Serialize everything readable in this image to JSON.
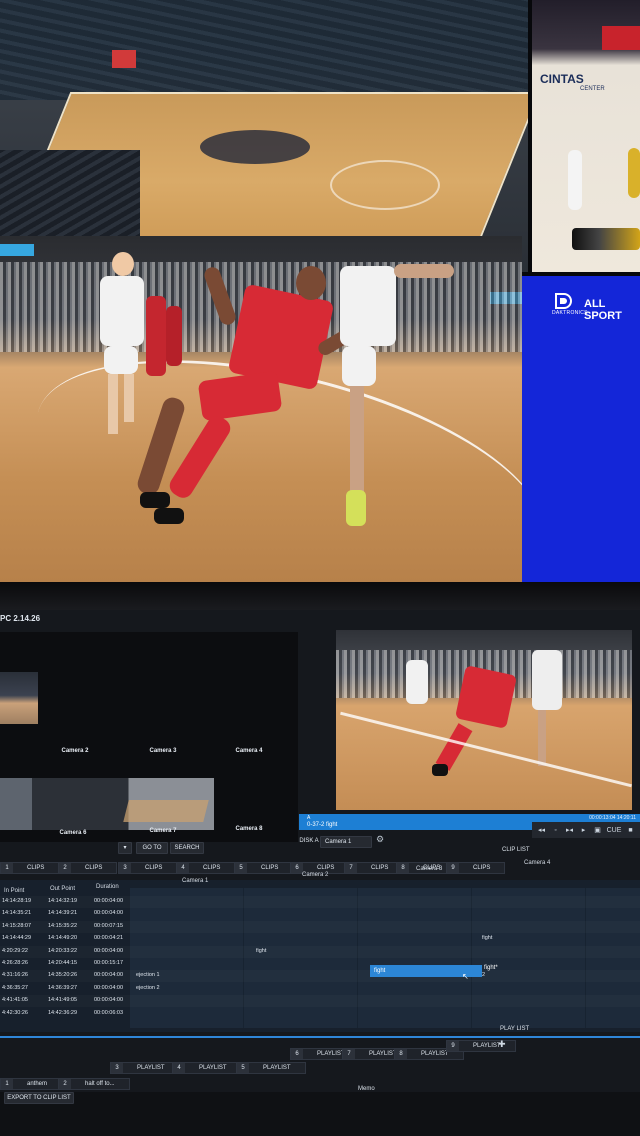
{
  "wall": {
    "sidecam_banner": "CINTAS",
    "sidecam_banner_sub": "CENTER",
    "bluegfx": {
      "brand": "ALL SPORT",
      "sub": "DAKTRONICS"
    }
  },
  "software": {
    "version": "PC 2.14.26",
    "cameras": [
      {
        "label": "Camera 2"
      },
      {
        "label": "Camera 3"
      },
      {
        "label": "Camera 4"
      },
      {
        "label": "Camera 6"
      },
      {
        "label": "Camera 7"
      },
      {
        "label": "Camera 8"
      }
    ],
    "clip": {
      "letter": "A",
      "name": "0-37-2  fight",
      "timecode": "00:00:13:04   14:20:11"
    },
    "transport": [
      "◂◂",
      "◦",
      "▸◂",
      "▸",
      "▣",
      "CUE",
      "■"
    ],
    "goto_label": "GO TO",
    "search_label": "SEARCH",
    "disk_label": "DISK A",
    "camera_select": "Camera 1",
    "cliplist_label": "CLIP LIST",
    "clip_tabs": [
      {
        "n": "1",
        "label": "CLIPS"
      },
      {
        "n": "2",
        "label": "CLIPS"
      },
      {
        "n": "3",
        "label": "CLIPS"
      },
      {
        "n": "4",
        "label": "CLIPS"
      },
      {
        "n": "5",
        "label": "CLIPS"
      },
      {
        "n": "6",
        "label": "CLIPS"
      },
      {
        "n": "7",
        "label": "CLIPS"
      },
      {
        "n": "8",
        "label": "CLIPS"
      },
      {
        "n": "9",
        "label": "CLIPS"
      }
    ],
    "columns": {
      "in_point": "In Point",
      "out_point": "Out Point",
      "duration": "Duration",
      "camera1": "Camera 1",
      "camera2": "Camera 2",
      "camera3": "Camera 3",
      "camera4": "Camera 4"
    },
    "rows": [
      {
        "in": "14:14:28:19",
        "out": "14:14:32:19",
        "dur": "00:00:04:00",
        "c1": "",
        "c2": "",
        "c3": ""
      },
      {
        "in": "14:14:35:21",
        "out": "14:14:39:21",
        "dur": "00:00:04:00",
        "c1": "",
        "c2": "",
        "c3": ""
      },
      {
        "in": "14:15:28:07",
        "out": "14:15:35:22",
        "dur": "00:00:07:15",
        "c1": "",
        "c2": "",
        "c3": ""
      },
      {
        "in": "14:14:44:29",
        "out": "14:14:49:20",
        "dur": "00:00:04:21",
        "c1": "",
        "c2": "",
        "c3": "fight"
      },
      {
        "in": "4:20:29:22",
        "out": "14:20:33:22",
        "dur": "00:00:04:00",
        "c1": "",
        "c2": "fight",
        "c3": ""
      },
      {
        "in": "4:26:28:26",
        "out": "14:20:44:15",
        "dur": "00:00:15:17",
        "c1": "",
        "c2": "",
        "c3": ""
      },
      {
        "in": "4:31:16:26",
        "out": "14:35:20:26",
        "dur": "00:00:04:00",
        "c1": "ejection 1",
        "c2": "",
        "c3": "2"
      },
      {
        "in": "4:36:35:27",
        "out": "14:36:39:27",
        "dur": "00:00:04:00",
        "c1": "ejection 2",
        "c2": "",
        "c3": ""
      },
      {
        "in": "4:41:41:05",
        "out": "14:41:49:05",
        "dur": "00:00:04:00",
        "c1": "",
        "c2": "",
        "c3": ""
      },
      {
        "in": "4:42:30:26",
        "out": "14:42:36:29",
        "dur": "00:00:06:03",
        "c1": "",
        "c2": "",
        "c3": ""
      }
    ],
    "selected_clip": "fight",
    "selected_clip_extra": "fight*",
    "playlist_label": "PLAY LIST",
    "playlist_tabs": [
      {
        "n": "1",
        "label": "anthem"
      },
      {
        "n": "2",
        "label": "halt off to..."
      },
      {
        "n": "3",
        "label": "PLAYLIST"
      },
      {
        "n": "4",
        "label": "PLAYLIST"
      },
      {
        "n": "5",
        "label": "PLAYLIST"
      },
      {
        "n": "6",
        "label": "PLAYLIST"
      },
      {
        "n": "7",
        "label": "PLAYLIST"
      },
      {
        "n": "8",
        "label": "PLAYLIST"
      },
      {
        "n": "9",
        "label": "PLAYLIST"
      }
    ],
    "export_label": "EXPORT TO CLIP LIST",
    "memo_label": "Memo"
  },
  "colors": {
    "accent_blue": "#1d7fd4",
    "graphic_blue": "#1426d8",
    "team_red": "#d72a35"
  }
}
